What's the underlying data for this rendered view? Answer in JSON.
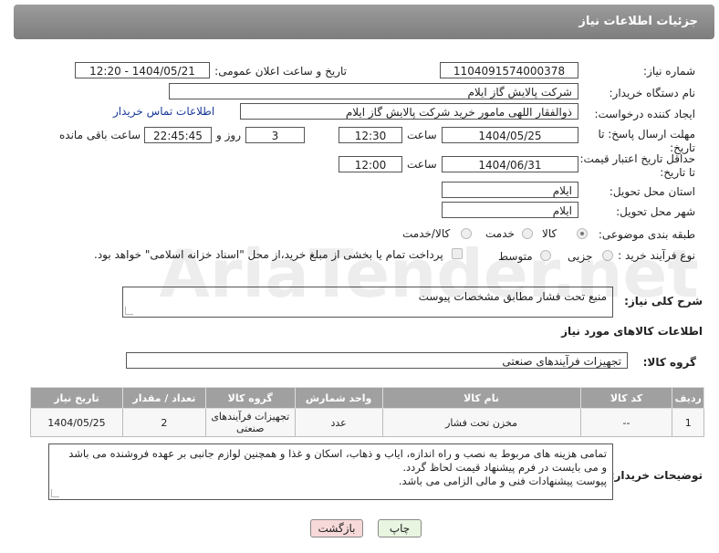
{
  "header": {
    "title": "جزئیات اطلاعات نیاز"
  },
  "fields": {
    "need_number_label": "شماره نیاز:",
    "need_number": "1104091574000378",
    "announce_label": "تاریخ و ساعت اعلان عمومی:",
    "announce_value": "1404/05/21 - 12:20",
    "buyer_label": "نام دستگاه خریدار:",
    "buyer_value": "شرکت پالایش گاز ایلام",
    "creator_label": "ایجاد کننده درخواست:",
    "creator_value": "ذوالفقار اللهی مامور خرید شرکت پالایش گاز ایلام",
    "buyer_contact_link": "اطلاعات تماس خریدار",
    "deadline_label": "مهلت ارسال پاسخ: تا تاریخ:",
    "deadline_date": "1404/05/25",
    "time_label": "ساعت",
    "deadline_time": "12:30",
    "days_value": "3",
    "days_label": "روز و",
    "remaining_time": "22:45:45",
    "remaining_label": "ساعت باقی مانده",
    "price_validity_label": "حداقل تاریخ اعتبار قیمت: تا تاریخ:",
    "price_validity_date": "1404/06/31",
    "price_validity_time": "12:00",
    "province_label": "استان محل تحویل:",
    "province_value": "ایلام",
    "city_label": "شهر محل تحویل:",
    "city_value": "ایلام",
    "category_label": "طبقه بندی موضوعی:",
    "category_options": [
      "کالا",
      "خدمت",
      "کالا/خدمت"
    ],
    "category_selected": "کالا",
    "process_label": "نوع فرآیند خرید :",
    "process_options": [
      "جزیی",
      "متوسط"
    ],
    "payment_note": "پرداخت تمام یا بخشی از مبلغ خرید،از محل \"اسناد خزانه اسلامی\" خواهد بود."
  },
  "summary": {
    "label": "شرح کلی نیاز:",
    "value": "منبع تحت فشار مطابق مشخصات پیوست"
  },
  "goods": {
    "section_title": "اطلاعات کالاهای مورد نیاز",
    "group_label": "گروه کالا:",
    "group_value": "تجهیزات فرآیندهای صنعتی",
    "columns": [
      "ردیف",
      "کد کالا",
      "نام کالا",
      "واحد شمارش",
      "گروه کالا",
      "تعداد / مقدار",
      "تاریخ نیاز"
    ],
    "rows": [
      {
        "row": "1",
        "code": "--",
        "name": "مخزن تحت فشار",
        "unit": "عدد",
        "group": "تجهیزات فرآیندهای صنعتی",
        "qty": "2",
        "date": "1404/05/25"
      }
    ]
  },
  "buyer_notes": {
    "label": "توضیحات خریدار:",
    "lines": [
      "تمامی هزینه های مربوط به نصب و راه اندازه، ایاب و ذهاب، اسکان و غذا و همچنین لوازم جانبی بر عهده فروشنده می باشد",
      "و می بایست در فرم پیشنهاد قیمت لحاظ گردد.",
      "پیوست پیشنهادات فنی و مالی الزامی می باشد."
    ]
  },
  "buttons": {
    "print": "چاپ",
    "back": "بازگشت"
  },
  "watermark": {
    "text": "AriaTender.net"
  },
  "colors": {
    "header_bg": "#8a8a8a",
    "link": "#1a3a9a",
    "back_btn_bg": "#f7d9d9",
    "print_btn_bg": "#e8f5e0"
  }
}
